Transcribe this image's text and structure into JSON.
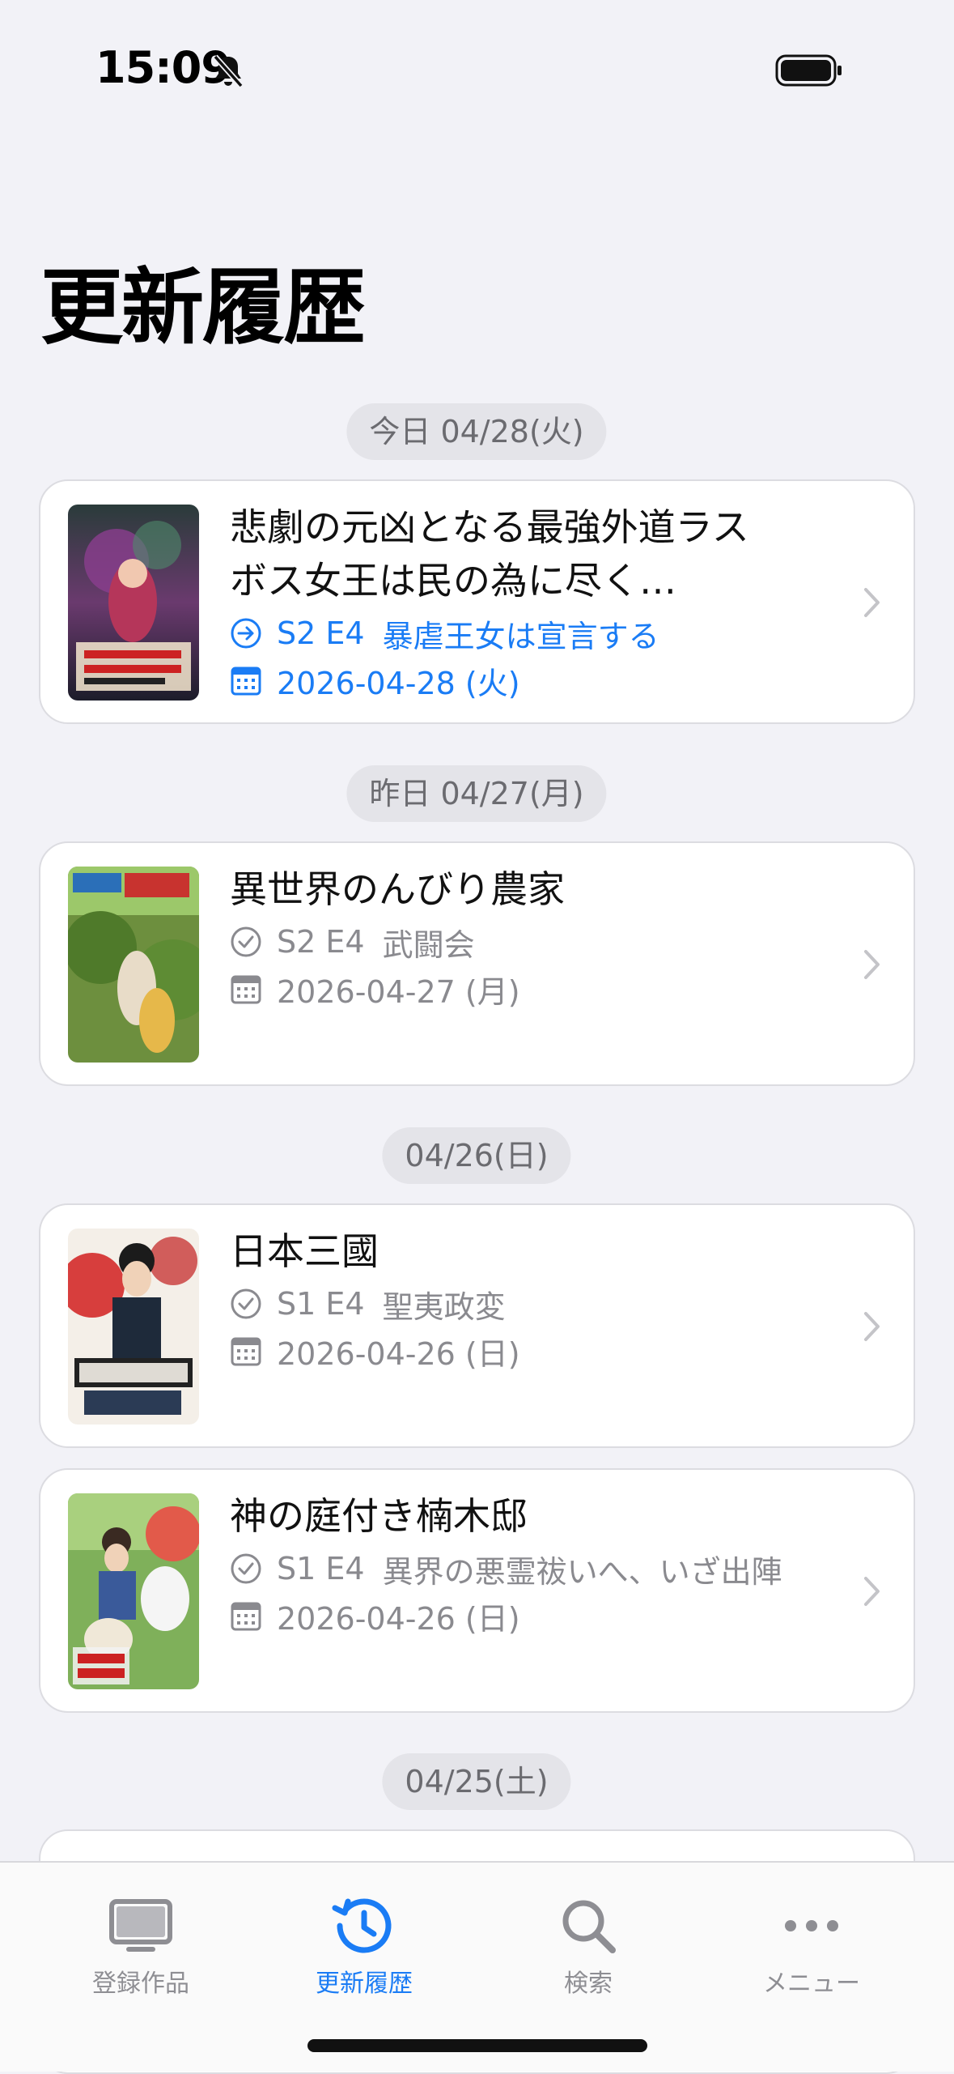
{
  "status_bar": {
    "time": "15:09"
  },
  "page_title": "更新履歴",
  "sections": [
    {
      "label": "今日 04/28(火)",
      "items": [
        {
          "title": "悲劇の元凶となる最強外道ラスボス女王は民の為に尽く…",
          "episode": "S2 E4",
          "episode_title": "暴虐王女は宣言する",
          "date": "2026-04-28 (火)",
          "status": "upcoming"
        }
      ]
    },
    {
      "label": "昨日 04/27(月)",
      "items": [
        {
          "title": "異世界のんびり農家",
          "episode": "S2 E4",
          "episode_title": "武闘会",
          "date": "2026-04-27 (月)",
          "status": "watched"
        }
      ]
    },
    {
      "label": "04/26(日)",
      "items": [
        {
          "title": "日本三國",
          "episode": "S1 E4",
          "episode_title": "聖夷政変",
          "date": "2026-04-26 (日)",
          "status": "watched"
        },
        {
          "title": "神の庭付き楠木邸",
          "episode": "S1 E4",
          "episode_title": "異界の悪霊祓いへ、いざ出陣",
          "date": "2026-04-26 (日)",
          "status": "watched"
        }
      ]
    },
    {
      "label": "04/25(土)",
      "items": []
    }
  ],
  "tab_bar": {
    "tabs": [
      {
        "label": "登録作品",
        "icon": "tv-icon",
        "active": false
      },
      {
        "label": "更新履歴",
        "icon": "history-icon",
        "active": true
      },
      {
        "label": "検索",
        "icon": "search-icon",
        "active": false
      },
      {
        "label": "メニュー",
        "icon": "more-icon",
        "active": false
      }
    ]
  },
  "colors": {
    "accent": "#1a7cf5",
    "background": "#f2f2f7",
    "inactive": "#8e8e93"
  }
}
